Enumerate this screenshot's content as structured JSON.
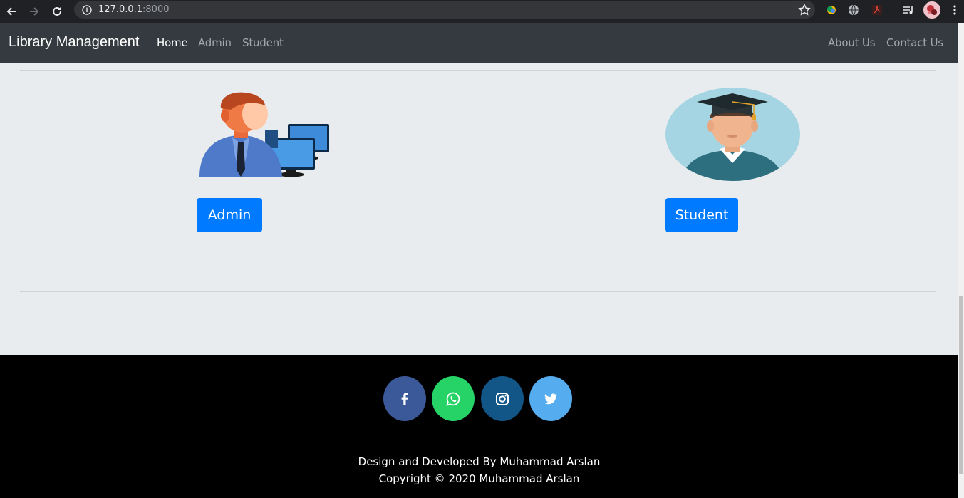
{
  "browser": {
    "url_host": "127.0.0.1",
    "url_port": ":8000"
  },
  "navbar": {
    "brand": "Library Management",
    "links": [
      {
        "label": "Home",
        "active": true
      },
      {
        "label": "Admin",
        "active": false
      },
      {
        "label": "Student",
        "active": false
      }
    ],
    "right_links": [
      {
        "label": "About Us"
      },
      {
        "label": "Contact Us"
      }
    ]
  },
  "main": {
    "admin_button": "Admin",
    "student_button": "Student"
  },
  "footer": {
    "social": [
      {
        "icon": "facebook-icon",
        "color": "#3b5998"
      },
      {
        "icon": "whatsapp-icon",
        "color": "#25d366"
      },
      {
        "icon": "instagram-icon",
        "color": "#125688"
      },
      {
        "icon": "twitter-icon",
        "color": "#55acee"
      }
    ],
    "credit": "Design and Developed By Muhammad Arslan",
    "copyright": "Copyright © 2020 Muhammad Arslan"
  }
}
